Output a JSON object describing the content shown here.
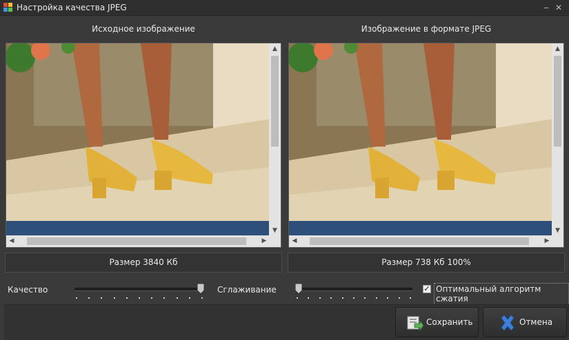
{
  "window": {
    "title": "Настройка качества JPEG"
  },
  "panels": {
    "original": {
      "title": "Исходное изображение",
      "size_text": "Размер 3840 Кб"
    },
    "jpeg": {
      "title": "Изображение в формате JPEG",
      "size_text": "Размер 738 Кб 100%"
    }
  },
  "controls": {
    "quality_label": "Качество",
    "quality_value": 1.0,
    "smoothing_label": "Сглаживание",
    "smoothing_value": 0.0,
    "optimal_checkbox_label": "Оптимальный алгоритм сжатия",
    "optimal_checked": true
  },
  "buttons": {
    "save_label": "Сохранить",
    "cancel_label": "Отмена"
  },
  "colors": {
    "background": "#3a3a3a",
    "titlebar": "#2f2f2f",
    "cancel_icon": "#3d7fd6",
    "save_icon": "#5fae5a"
  }
}
